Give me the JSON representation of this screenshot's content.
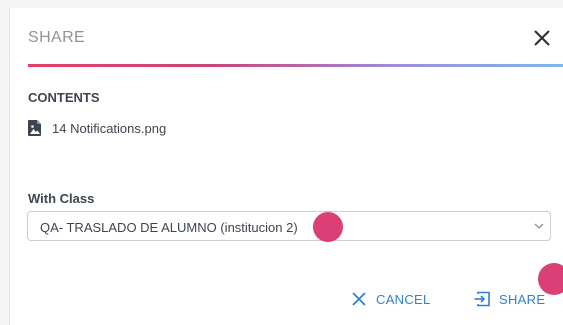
{
  "dialog": {
    "title": "SHARE",
    "close_icon": "close-icon"
  },
  "contents": {
    "label": "CONTENTS",
    "file": {
      "icon": "image-file-icon",
      "name": "14 Notifications.png"
    }
  },
  "with_class": {
    "label": "With Class",
    "selected_value": "QA- TRASLADO DE ALUMNO (institucion 2)",
    "chevron_icon": "chevron-down-icon"
  },
  "actions": {
    "cancel_label": "CANCEL",
    "cancel_icon": "x-icon",
    "share_label": "SHARE",
    "share_icon": "share-arrow-icon"
  },
  "colors": {
    "accent_gradient": [
      "#e14068",
      "#c8447a",
      "#9d8fde",
      "#7eb6ef"
    ],
    "action_blue": "#2f7fd3",
    "touch_dot": "#dc3e76"
  }
}
